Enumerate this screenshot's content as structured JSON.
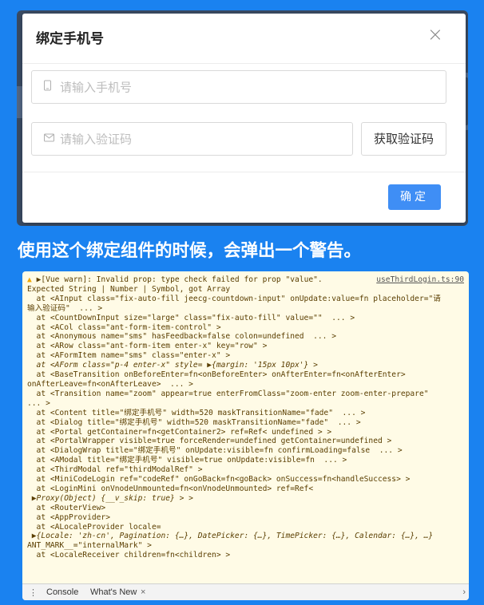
{
  "modal": {
    "title": "绑定手机号",
    "close_icon": "×",
    "phone_placeholder": "请输入手机号",
    "code_placeholder": "请输入验证码",
    "get_code_label": "获取验证码",
    "ok_label": "确定"
  },
  "caption": "使用这个绑定组件的时候，会弹出一个警告。",
  "console": {
    "source_link": "useThirdLogin.ts:90",
    "lines": [
      "▶[Vue warn]: Invalid prop: type check failed for prop \"value\".",
      "Expected String | Number | Symbol, got Array",
      "  at <AInput class=\"fix-auto-fill jeecg-countdown-input\" onUpdate:value=fn placeholder=\"请",
      "输入验证码\"  ... >",
      "  at <CountDownInput size=\"large\" class=\"fix-auto-fill\" value=\"\"  ... >",
      "  at <ACol class=\"ant-form-item-control\" >",
      "  at <Anonymous name=\"sms\" hasFeedback=false colon=undefined  ... >",
      "  at <ARow class=\"ant-form-item enter-x\" key=\"row\" >",
      "  at <AFormItem name=\"sms\" class=\"enter-x\" >",
      "  at <AForm class=\"p-4 enter-x\" style= ▶{margin: '15px 10px'} >",
      "  at <BaseTransition onBeforeEnter=fn<onBeforeEnter> onAfterEnter=fn<onAfterEnter>",
      "onAfterLeave=fn<onAfterLeave>  ... >",
      "  at <Transition name=\"zoom\" appear=true enterFromClass=\"zoom-enter zoom-enter-prepare\"",
      "... >",
      "  at <Content title=\"绑定手机号\" width=520 maskTransitionName=\"fade\"  ... >",
      "  at <Dialog title=\"绑定手机号\" width=520 maskTransitionName=\"fade\"  ... >",
      "  at <Portal getContainer=fn<getContainer2> ref=Ref< undefined > >",
      "  at <PortalWrapper visible=true forceRender=undefined getContainer=undefined >",
      "  at <DialogWrap title=\"绑定手机号\" onUpdate:visible=fn confirmLoading=false  ... >",
      "  at <AModal title=\"绑定手机号\" visible=true onUpdate:visible=fn  ... >",
      "  at <ThirdModal ref=\"thirdModalRef\" >",
      "  at <MiniCodeLogin ref=\"codeRef\" onGoBack=fn<goBack> onSuccess=fn<handleSuccess> >",
      "  at <LoginMini onVnodeUnmounted=fn<onVnodeUnmounted> ref=Ref<",
      " ▶Proxy(Object) {__v_skip: true} > >",
      "  at <RouterView>",
      "  at <AppProvider>",
      "  at <ALocaleProvider locale=",
      " ▶{Locale: 'zh-cn', Pagination: {…}, DatePicker: {…}, TimePicker: {…}, Calendar: {…}, …}",
      "ANT_MARK__=\"internalMark\" >",
      "  at <LocaleReceiver children=fn<children> >"
    ]
  },
  "drawer": {
    "menu_icon": "⋮",
    "tab_console": "Console",
    "tab_whats_new": "What's New",
    "close_icon": "×",
    "arrow_icon": "›"
  }
}
